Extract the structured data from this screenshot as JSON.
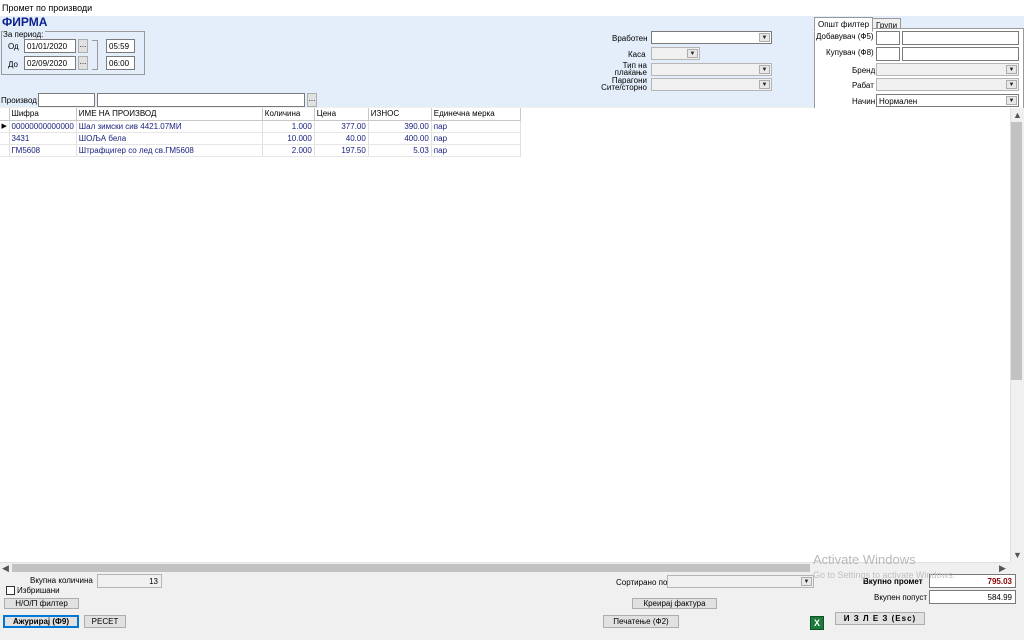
{
  "window": {
    "title": "Промет по производи"
  },
  "header": {
    "company": "ФИРМА",
    "period_label": "За период:",
    "from_label": "Од",
    "to_label": "До",
    "from_date": "01/01/2020",
    "to_date": "02/09/2020",
    "from_time": "05:59",
    "to_time": "06:00",
    "dots": "...",
    "product_label": "Производ",
    "employee_label": "Вработен",
    "cashbox_label": "Каса",
    "payment_type_label": "Тип на плаќање",
    "receipts_label": "Парагони Сите/сторно"
  },
  "filters": {
    "tabs": [
      "Општ филтер",
      "Групи"
    ],
    "supplier_label": "Добавувач (Ф5)",
    "buyer_label": "Купувач (Ф8)",
    "brand_label": "Бренд",
    "discount_label": "Рабат",
    "mode_label": "Начин",
    "mode_value": "Нормален"
  },
  "grid": {
    "columns": [
      "Шифра",
      "ИМЕ НА ПРОИЗВОД",
      "Количина",
      "Цена",
      "ИЗНОС",
      "Единечна мерка"
    ],
    "rows": [
      {
        "code": "00000000000000",
        "name": "Шал зимски сив 4421.07МИ",
        "qty": "1.000",
        "price": "377.00",
        "amount": "390.00",
        "unit": "пар"
      },
      {
        "code": "3431",
        "name": "ШОЉА бела",
        "qty": "10.000",
        "price": "40.00",
        "amount": "400.00",
        "unit": "пар"
      },
      {
        "code": "ГМ5608",
        "name": "Штрафцигер со лед св.ГМ5608",
        "qty": "2.000",
        "price": "197.50",
        "amount": "5.03",
        "unit": "пар"
      }
    ]
  },
  "footer": {
    "total_qty_label": "Вкупна количина",
    "total_qty_value": "13",
    "deleted_label": "Избришани",
    "nop_filter_button": "Н/О/П филтер",
    "update_button": "Ажурирај (Ф9)",
    "reset_button": "РЕСЕТ",
    "sort_label": "Сортирано по",
    "create_invoice_button": "Креирај фактура",
    "print_button": "Печатење (Ф2)",
    "total_turnover_label": "Вкупно промет",
    "total_turnover_value": "795.03",
    "total_discount_label": "Вкупен попуст",
    "total_discount_value": "584.99",
    "exit_button": "И З Л Е З (Esc)",
    "excel_icon_glyph": "X"
  },
  "os": {
    "activate_title": "Activate Windows",
    "activate_sub": "Go to Settings to activate Windows."
  },
  "colors": {
    "accent": "#0a1f8c",
    "header_bg": "#e4eefa",
    "total_value": "#8b0000"
  }
}
